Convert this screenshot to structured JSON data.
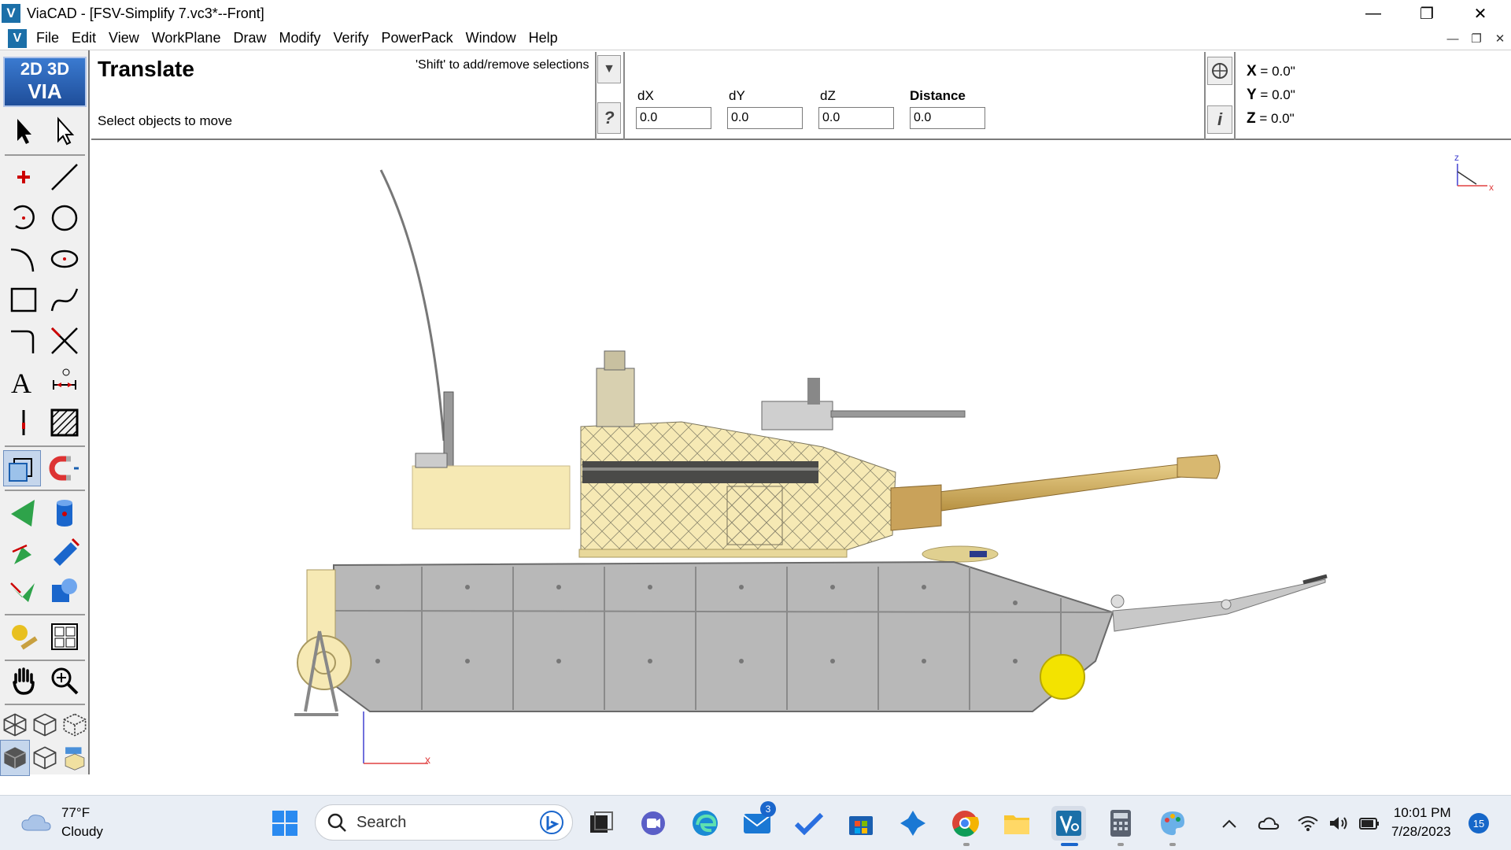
{
  "window": {
    "title": "ViaCAD - [FSV-Simplify 7.vc3*--Front]",
    "app_icon": "V",
    "controls": [
      "minimize-icon",
      "restore-icon",
      "close-icon"
    ]
  },
  "menu": {
    "items": [
      "File",
      "Edit",
      "View",
      "WorkPlane",
      "Draw",
      "Modify",
      "Verify",
      "PowerPack",
      "Window",
      "Help"
    ]
  },
  "toolbar": {
    "logo_line1": "2D 3D",
    "logo_line2": "VIA"
  },
  "command": {
    "title": "Translate",
    "prompt": "Select objects to move",
    "hint": "'Shift' to add/remove selections",
    "fields": [
      {
        "label": "dX",
        "value": "0.0"
      },
      {
        "label": "dY",
        "value": "0.0"
      },
      {
        "label": "dZ",
        "value": "0.0"
      },
      {
        "label": "Distance",
        "value": "0.0"
      }
    ],
    "help_label": "?",
    "info_label": "i"
  },
  "coordinates": {
    "x_label": "X",
    "x_value": "= 0.0\"",
    "y_label": "Y",
    "y_value": "= 0.0\"",
    "z_label": "Z",
    "z_value": "= 0.0\""
  },
  "viewport": {
    "axis_labels": {
      "x": "x",
      "z": "z"
    },
    "colors": {
      "hull": "#b8b8b8",
      "turret": "#f6e9b4",
      "barrel": "#c9a25a",
      "wheel": "#f3e300",
      "axis_x": "#e04040",
      "axis_z": "#4040d0"
    }
  },
  "taskbar": {
    "weather_temp": "77°F",
    "weather_desc": "Cloudy",
    "search_placeholder": "Search",
    "mail_badge": "3",
    "time": "10:01 PM",
    "date": "7/28/2023",
    "notifications": "15"
  }
}
